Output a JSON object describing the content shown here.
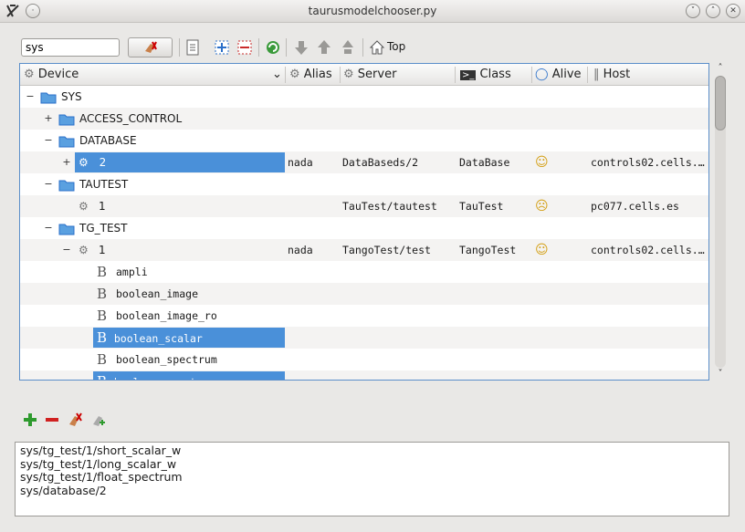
{
  "window": {
    "title": "taurusmodelchooser.py",
    "buttons": [
      "help-icon",
      "minimize-icon",
      "maximize-icon",
      "close-icon"
    ]
  },
  "toolbar": {
    "search_value": "sys",
    "top_label": "Top"
  },
  "tree": {
    "columns": [
      "Device",
      "Alias",
      "Server",
      "Class",
      "Alive",
      "Host"
    ],
    "rows": [
      {
        "label": "SYS",
        "alias": "",
        "server": "",
        "klass": "",
        "alive": "",
        "host": ""
      },
      {
        "label": "ACCESS_CONTROL",
        "alias": "",
        "server": "",
        "klass": "",
        "alive": "",
        "host": ""
      },
      {
        "label": "DATABASE",
        "alias": "",
        "server": "",
        "klass": "",
        "alive": "",
        "host": ""
      },
      {
        "label": "2",
        "alias": "nada",
        "server": "DataBaseds/2",
        "klass": "DataBase",
        "alive": "☺",
        "host": "controls02.cells.…"
      },
      {
        "label": "TAUTEST",
        "alias": "",
        "server": "",
        "klass": "",
        "alive": "",
        "host": ""
      },
      {
        "label": "1",
        "alias": "",
        "server": "TauTest/tautest",
        "klass": "TauTest",
        "alive": "☹",
        "host": "pc077.cells.es"
      },
      {
        "label": "TG_TEST",
        "alias": "",
        "server": "",
        "klass": "",
        "alive": "",
        "host": ""
      },
      {
        "label": "1",
        "alias": "nada",
        "server": "TangoTest/test",
        "klass": "TangoTest",
        "alive": "☺",
        "host": "controls02.cells.…"
      },
      {
        "label": "ampli",
        "alias": "",
        "server": "",
        "klass": "",
        "alive": "",
        "host": ""
      },
      {
        "label": "boolean_image",
        "alias": "",
        "server": "",
        "klass": "",
        "alive": "",
        "host": ""
      },
      {
        "label": "boolean_image_ro",
        "alias": "",
        "server": "",
        "klass": "",
        "alive": "",
        "host": ""
      },
      {
        "label": "boolean_scalar",
        "alias": "",
        "server": "",
        "klass": "",
        "alive": "",
        "host": ""
      },
      {
        "label": "boolean_spectrum",
        "alias": "",
        "server": "",
        "klass": "",
        "alive": "",
        "host": ""
      },
      {
        "label": "boolean_spectrum_ro",
        "alias": "",
        "server": "",
        "klass": "",
        "alive": "",
        "host": ""
      }
    ]
  },
  "selected_models": [
    "sys/tg_test/1/short_scalar_w",
    "sys/tg_test/1/long_scalar_w",
    "sys/tg_test/1/float_spectrum",
    "sys/database/2"
  ],
  "colors": {
    "selection": "#4a90d9",
    "accent_border": "#5b8ec9"
  }
}
